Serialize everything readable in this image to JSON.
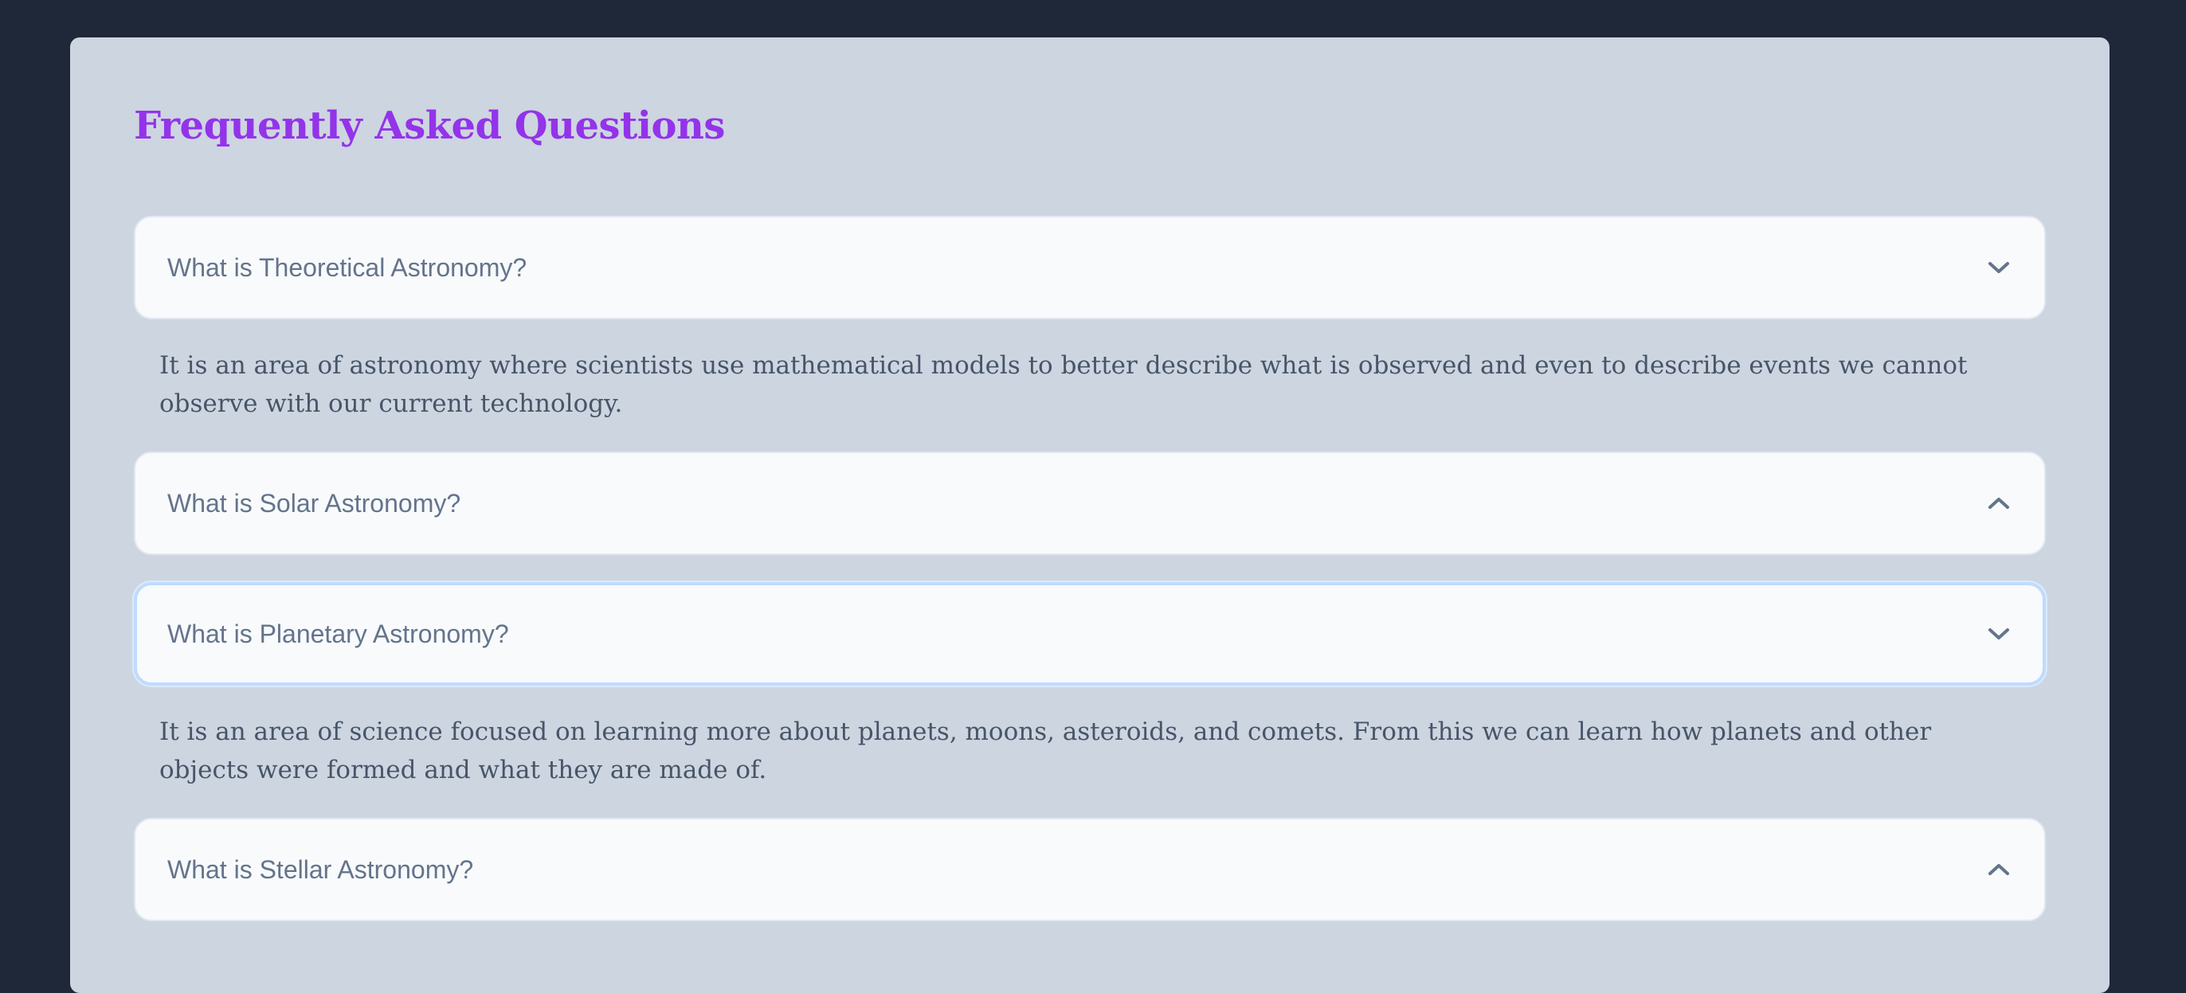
{
  "header": {
    "title": "Frequently Asked Questions"
  },
  "colors": {
    "page_background": "#1f2839",
    "panel_background": "#cdd5e0",
    "title_accent": "#9333ea",
    "question_text": "#64748b",
    "answer_text": "#475569",
    "card_background": "#f8fafc",
    "focus_ring": "#bfdbfe"
  },
  "faq": {
    "items": [
      {
        "question": "What is Theoretical Astronomy?",
        "answer": "It is an area of astronomy where scientists use mathematical models to better describe what is observed and even to describe events we cannot observe with our current technology.",
        "icon": "chevron-down-icon",
        "expanded": true
      },
      {
        "question": "What is Solar Astronomy?",
        "answer": "",
        "icon": "chevron-up-icon",
        "expanded": false
      },
      {
        "question": "What is Planetary Astronomy?",
        "answer": "It is an area of science focused on learning more about planets, moons, asteroids, and comets. From this we can learn how planets and other objects were formed and what they are made of.",
        "icon": "chevron-down-icon",
        "expanded": true,
        "focused": true
      },
      {
        "question": "What is Stellar Astronomy?",
        "answer": "",
        "icon": "chevron-up-icon",
        "expanded": false
      }
    ]
  }
}
